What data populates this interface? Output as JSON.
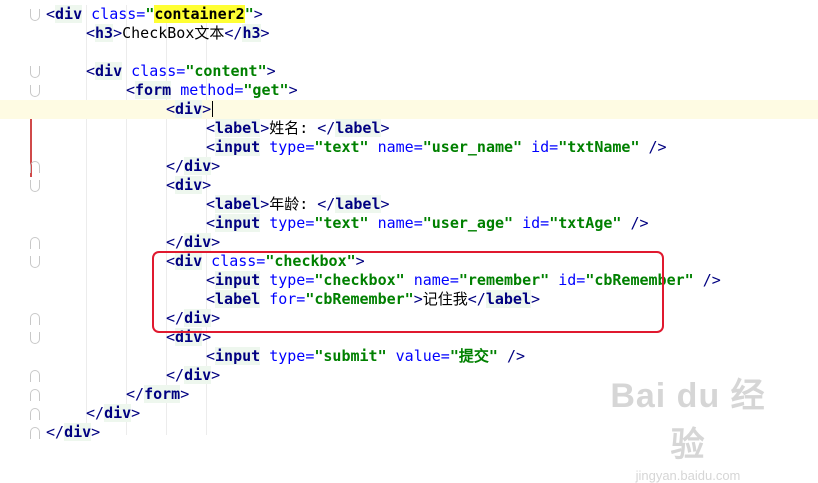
{
  "editor": {
    "lines": [
      {
        "indent": 0,
        "tokens": [
          [
            "tag",
            "<"
          ],
          [
            "name",
            "div"
          ],
          [
            "text",
            " "
          ],
          [
            "attr",
            "class="
          ],
          [
            "val",
            "\""
          ],
          [
            "valhl",
            "container2"
          ],
          [
            "val",
            "\""
          ],
          [
            "tag",
            ">"
          ]
        ]
      },
      {
        "indent": 1,
        "tokens": [
          [
            "tag",
            "<"
          ],
          [
            "name",
            "h3"
          ],
          [
            "tag",
            ">"
          ],
          [
            "text",
            "CheckBox文本"
          ],
          [
            "tag",
            "</"
          ],
          [
            "name",
            "h3"
          ],
          [
            "tag",
            ">"
          ]
        ]
      },
      {
        "indent": 0,
        "tokens": []
      },
      {
        "indent": 1,
        "tokens": [
          [
            "tag",
            "<"
          ],
          [
            "name",
            "div"
          ],
          [
            "text",
            " "
          ],
          [
            "attr",
            "class="
          ],
          [
            "val",
            "\"content\""
          ],
          [
            "tag",
            ">"
          ]
        ]
      },
      {
        "indent": 2,
        "tokens": [
          [
            "tag",
            "<"
          ],
          [
            "name",
            "form"
          ],
          [
            "text",
            " "
          ],
          [
            "attr",
            "method="
          ],
          [
            "val",
            "\"get\""
          ],
          [
            "tag",
            ">"
          ]
        ]
      },
      {
        "indent": 3,
        "current": true,
        "tokens": [
          [
            "tag",
            "<"
          ],
          [
            "name",
            "div"
          ],
          [
            "tag",
            ">"
          ]
        ]
      },
      {
        "indent": 4,
        "tokens": [
          [
            "tag",
            "<"
          ],
          [
            "name",
            "label"
          ],
          [
            "tag",
            ">"
          ],
          [
            "text",
            "姓名: "
          ],
          [
            "tag",
            "</"
          ],
          [
            "name",
            "label"
          ],
          [
            "tag",
            ">"
          ]
        ]
      },
      {
        "indent": 4,
        "tokens": [
          [
            "tag",
            "<"
          ],
          [
            "name",
            "input"
          ],
          [
            "text",
            " "
          ],
          [
            "attr",
            "type="
          ],
          [
            "val",
            "\"text\""
          ],
          [
            "text",
            " "
          ],
          [
            "attr",
            "name="
          ],
          [
            "val",
            "\"user_name\""
          ],
          [
            "text",
            " "
          ],
          [
            "attr",
            "id="
          ],
          [
            "val",
            "\"txtName\""
          ],
          [
            "text",
            " "
          ],
          [
            "tag",
            "/>"
          ]
        ]
      },
      {
        "indent": 3,
        "tokens": [
          [
            "tag",
            "</"
          ],
          [
            "name",
            "div"
          ],
          [
            "tag",
            ">"
          ]
        ]
      },
      {
        "indent": 3,
        "tokens": [
          [
            "tag",
            "<"
          ],
          [
            "name",
            "div"
          ],
          [
            "tag",
            ">"
          ]
        ]
      },
      {
        "indent": 4,
        "tokens": [
          [
            "tag",
            "<"
          ],
          [
            "name",
            "label"
          ],
          [
            "tag",
            ">"
          ],
          [
            "text",
            "年龄: "
          ],
          [
            "tag",
            "</"
          ],
          [
            "name",
            "label"
          ],
          [
            "tag",
            ">"
          ]
        ]
      },
      {
        "indent": 4,
        "tokens": [
          [
            "tag",
            "<"
          ],
          [
            "name",
            "input"
          ],
          [
            "text",
            " "
          ],
          [
            "attr",
            "type="
          ],
          [
            "val",
            "\"text\""
          ],
          [
            "text",
            " "
          ],
          [
            "attr",
            "name="
          ],
          [
            "val",
            "\"user_age\""
          ],
          [
            "text",
            " "
          ],
          [
            "attr",
            "id="
          ],
          [
            "val",
            "\"txtAge\""
          ],
          [
            "text",
            " "
          ],
          [
            "tag",
            "/>"
          ]
        ]
      },
      {
        "indent": 3,
        "tokens": [
          [
            "tag",
            "</"
          ],
          [
            "name",
            "div"
          ],
          [
            "tag",
            ">"
          ]
        ]
      },
      {
        "indent": 3,
        "tokens": [
          [
            "tag",
            "<"
          ],
          [
            "name",
            "div"
          ],
          [
            "text",
            " "
          ],
          [
            "attr",
            "class="
          ],
          [
            "val",
            "\"checkbox\""
          ],
          [
            "tag",
            ">"
          ]
        ]
      },
      {
        "indent": 4,
        "tokens": [
          [
            "tag",
            "<"
          ],
          [
            "name",
            "input"
          ],
          [
            "text",
            " "
          ],
          [
            "attr",
            "type="
          ],
          [
            "val",
            "\"checkbox\""
          ],
          [
            "text",
            " "
          ],
          [
            "attr",
            "name="
          ],
          [
            "val",
            "\"remember\""
          ],
          [
            "text",
            " "
          ],
          [
            "attr",
            "id="
          ],
          [
            "val",
            "\"cbRemember\""
          ],
          [
            "text",
            " "
          ],
          [
            "tag",
            "/>"
          ]
        ]
      },
      {
        "indent": 4,
        "tokens": [
          [
            "tag",
            "<"
          ],
          [
            "name",
            "label"
          ],
          [
            "text",
            " "
          ],
          [
            "attr",
            "for="
          ],
          [
            "val",
            "\"cbRemember\""
          ],
          [
            "tag",
            ">"
          ],
          [
            "text",
            "记住我"
          ],
          [
            "tag",
            "</"
          ],
          [
            "name",
            "label"
          ],
          [
            "tag",
            ">"
          ]
        ]
      },
      {
        "indent": 3,
        "tokens": [
          [
            "tag",
            "</"
          ],
          [
            "name",
            "div"
          ],
          [
            "tag",
            ">"
          ]
        ]
      },
      {
        "indent": 3,
        "tokens": [
          [
            "tag",
            "<"
          ],
          [
            "name",
            "div"
          ],
          [
            "tag",
            ">"
          ]
        ]
      },
      {
        "indent": 4,
        "tokens": [
          [
            "tag",
            "<"
          ],
          [
            "name",
            "input"
          ],
          [
            "text",
            " "
          ],
          [
            "attr",
            "type="
          ],
          [
            "val",
            "\"submit\""
          ],
          [
            "text",
            " "
          ],
          [
            "attr",
            "value="
          ],
          [
            "val",
            "\"提交\""
          ],
          [
            "text",
            " "
          ],
          [
            "tag",
            "/>"
          ]
        ]
      },
      {
        "indent": 3,
        "tokens": [
          [
            "tag",
            "</"
          ],
          [
            "name",
            "div"
          ],
          [
            "tag",
            ">"
          ]
        ]
      },
      {
        "indent": 2,
        "tokens": [
          [
            "tag",
            "</"
          ],
          [
            "name",
            "form"
          ],
          [
            "tag",
            ">"
          ]
        ]
      },
      {
        "indent": 1,
        "tokens": [
          [
            "tag",
            "</"
          ],
          [
            "name",
            "div"
          ],
          [
            "tag",
            ">"
          ]
        ]
      },
      {
        "indent": 0,
        "tokens": [
          [
            "tag",
            "</"
          ],
          [
            "name",
            "div"
          ],
          [
            "tag",
            ">"
          ]
        ]
      }
    ]
  },
  "colors": {
    "tag": "#000080",
    "attribute": "#0000ff",
    "value": "#008000",
    "tag_name_bg": "#eef7ee",
    "value_highlight_bg": "#ffff33",
    "unmatched_tag_bg": "#f8d7dc",
    "current_line_bg": "#fefbe3",
    "annotation_border": "#e0192f"
  },
  "watermark": {
    "brand": "Bai du 经验",
    "sub": "jingyan.baidu.com"
  }
}
